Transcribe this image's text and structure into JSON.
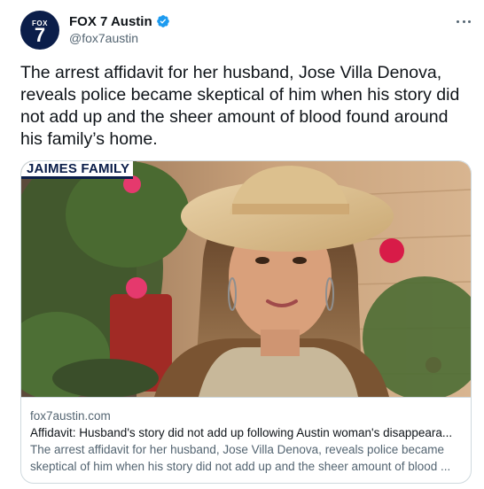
{
  "account": {
    "display_name": "FOX 7 Austin",
    "handle": "@fox7austin",
    "avatar_text_small": "FOX",
    "avatar_text_large": "7",
    "verified": true
  },
  "tweet": {
    "text": "The arrest affidavit for her husband, Jose Villa Denova, reveals police became skeptical of him when his story did not add up and the sheer amount of blood found around his family’s home."
  },
  "card": {
    "image_banner": "JAIMES FAMILY",
    "domain": "fox7austin.com",
    "title": "Affidavit: Husband's story did not add up following Austin woman's disappeara...",
    "description": "The arrest affidavit for her husband, Jose Villa Denova, reveals police became skeptical of him when his story did not add up and the sheer amount of blood ..."
  },
  "icons": {
    "verified": "verified-badge-icon",
    "more": "more-options-icon"
  },
  "colors": {
    "verified_blue": "#1d9bf0",
    "brand_navy": "#0b1e4a",
    "secondary_text": "#536471",
    "border": "#cfd9de"
  }
}
